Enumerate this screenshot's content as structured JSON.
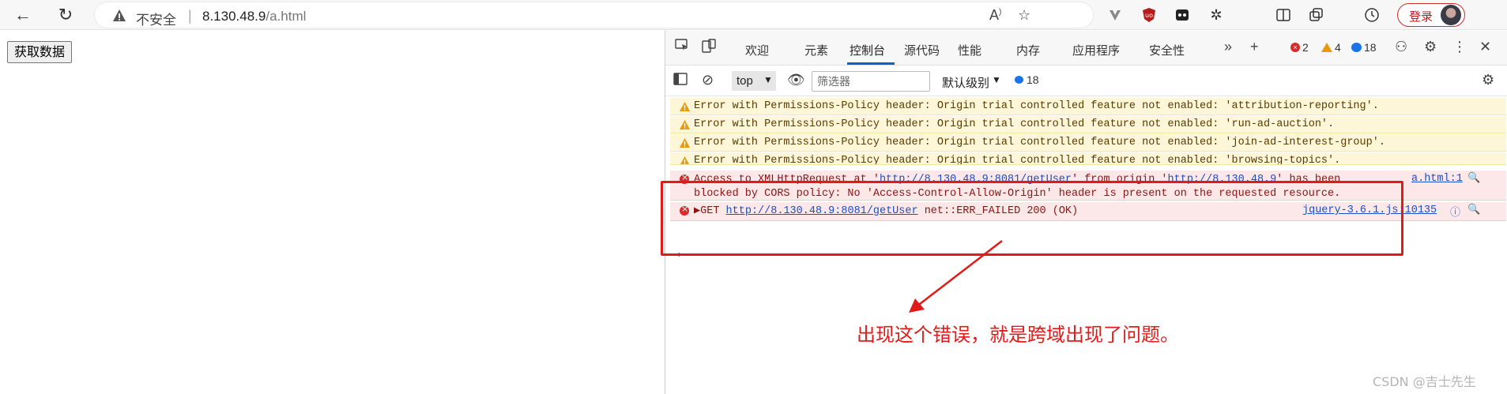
{
  "browser": {
    "security_label": "不安全",
    "url_host": "8.130.48.9",
    "url_path": "/a.html",
    "login_label": "登录"
  },
  "page": {
    "fetch_button": "获取数据"
  },
  "devtools": {
    "tabs": [
      "欢迎",
      "元素",
      "控制台",
      "源代码",
      "性能",
      "内存",
      "应用程序",
      "安全性"
    ],
    "active_tab": "控制台",
    "error_count": "2",
    "warning_count": "4",
    "message_count": "18",
    "context": "top",
    "filter_placeholder": "筛选器",
    "level": "默认级别",
    "filter_msg_count": "18"
  },
  "console": {
    "warnings": [
      "Error with Permissions-Policy header: Origin trial controlled feature not enabled: 'attribution-reporting'.",
      "Error with Permissions-Policy header: Origin trial controlled feature not enabled: 'run-ad-auction'.",
      "Error with Permissions-Policy header: Origin trial controlled feature not enabled: 'join-ad-interest-group'.",
      "Error with Permissions-Policy header: Origin trial controlled feature not enabled: 'browsing-topics'."
    ],
    "cors_error": {
      "line1_pre": "Access to XMLHttpRequest at '",
      "line1_url": "http://8.130.48.9:8081/getUser",
      "line1_mid": "' from origin '",
      "line1_origin": "http://8.130.48.9",
      "line1_post": "' has been",
      "line2": "blocked by CORS policy: No 'Access-Control-Allow-Origin' header is present on the requested resource.",
      "source": "a.html:1"
    },
    "get_error": {
      "prefix": "▶GET ",
      "url": "http://8.130.48.9:8081/getUser",
      "suffix": " net::ERR_FAILED 200 (OK)",
      "source": "jquery-3.6.1.js:10135"
    }
  },
  "annotation": {
    "text": "出现这个错误，就是跨域出现了问题。",
    "color": "#e21a1a"
  },
  "watermark": "CSDN @吉士先生"
}
